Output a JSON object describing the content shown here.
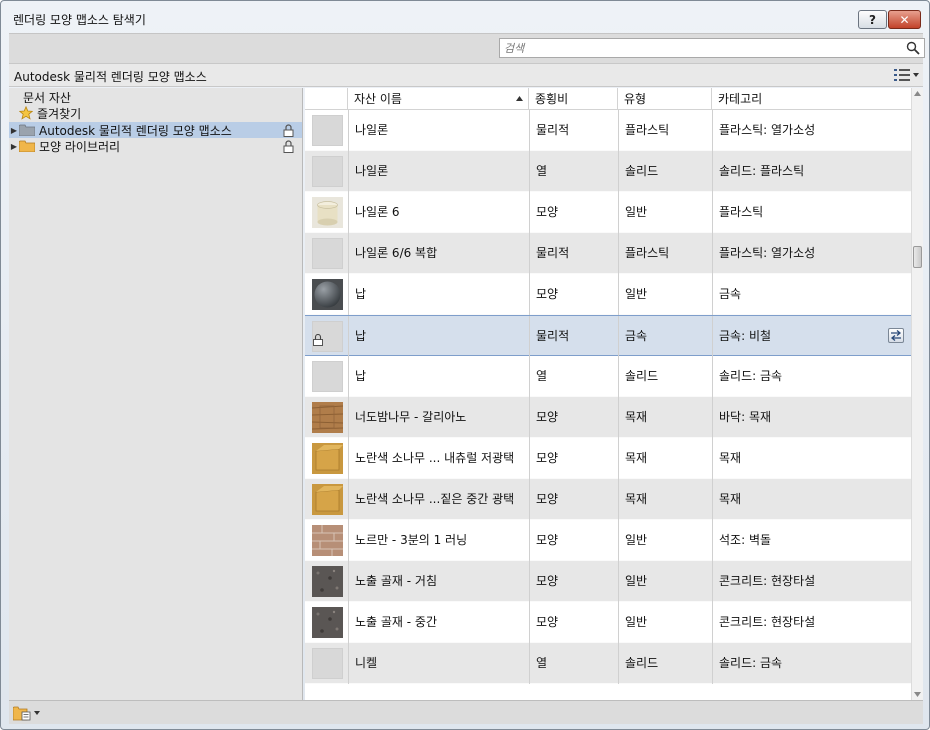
{
  "window": {
    "title": "렌더링 모양 맵소스 탐색기",
    "help_label": "?",
    "close_label": "✕"
  },
  "search": {
    "placeholder": "검색"
  },
  "library_header": {
    "title": "Autodesk 물리적 렌더링 모양 맵소스"
  },
  "tree": {
    "document_assets": "문서 자산",
    "favorites": "즐겨찾기",
    "items": [
      {
        "label": "Autodesk 물리적 렌더링 모양 맵소스",
        "selected": true,
        "locked": true
      },
      {
        "label": "모양 라이브러리",
        "selected": false,
        "locked": true
      }
    ]
  },
  "table": {
    "columns": [
      "자산 이름",
      "종횡비",
      "유형",
      "카테고리"
    ],
    "sort_column": "자산 이름",
    "sort_direction": "ascending",
    "rows": [
      {
        "name": "나일론",
        "aspect": "물리적",
        "type": "플라스틱",
        "category": "플라스틱: 열가소성",
        "thumb": "blank",
        "shade": "white"
      },
      {
        "name": "나일론",
        "aspect": "열",
        "type": "솔리드",
        "category": "솔리드: 플라스틱",
        "thumb": "blank",
        "shade": "alt"
      },
      {
        "name": "나일론 6",
        "aspect": "모양",
        "type": "일반",
        "category": "플라스틱",
        "thumb": "cylinder",
        "shade": "white"
      },
      {
        "name": "나일론 6/6 복합",
        "aspect": "물리적",
        "type": "플라스틱",
        "category": "플라스틱: 열가소성",
        "thumb": "blank",
        "shade": "alt"
      },
      {
        "name": "납",
        "aspect": "모양",
        "type": "일반",
        "category": "금속",
        "thumb": "sphere",
        "shade": "white"
      },
      {
        "name": "납",
        "aspect": "물리적",
        "type": "금속",
        "category": "금속: 비철",
        "thumb": "blank",
        "shade": "sel",
        "locked": true,
        "swap": true
      },
      {
        "name": "납",
        "aspect": "열",
        "type": "솔리드",
        "category": "솔리드: 금속",
        "thumb": "blank",
        "shade": "white"
      },
      {
        "name": "너도밤나무 - 갈리아노",
        "aspect": "모양",
        "type": "목재",
        "category": "바닥: 목재",
        "thumb": "wood",
        "shade": "alt"
      },
      {
        "name": "노란색 소나무 ... 내츄럴 저광택",
        "aspect": "모양",
        "type": "목재",
        "category": "목재",
        "thumb": "pine",
        "shade": "white"
      },
      {
        "name": "노란색 소나무 ...짙은 중간 광택",
        "aspect": "모양",
        "type": "목재",
        "category": "목재",
        "thumb": "pine",
        "shade": "alt"
      },
      {
        "name": "노르만 - 3분의 1 러닝",
        "aspect": "모양",
        "type": "일반",
        "category": "석조: 벽돌",
        "thumb": "brick",
        "shade": "white"
      },
      {
        "name": "노출 골재 - 거침",
        "aspect": "모양",
        "type": "일반",
        "category": "콘크리트: 현장타설",
        "thumb": "concrete",
        "shade": "alt"
      },
      {
        "name": "노출 골재 - 중간",
        "aspect": "모양",
        "type": "일반",
        "category": "콘크리트: 현장타설",
        "thumb": "concrete",
        "shade": "white"
      },
      {
        "name": "니켈",
        "aspect": "열",
        "type": "솔리드",
        "category": "솔리드: 금속",
        "thumb": "blank",
        "shade": "alt"
      }
    ]
  },
  "colors": {
    "selection": "#d5dfec",
    "tree_selection": "#b9cde6",
    "alt_row": "#e7e7e7"
  }
}
